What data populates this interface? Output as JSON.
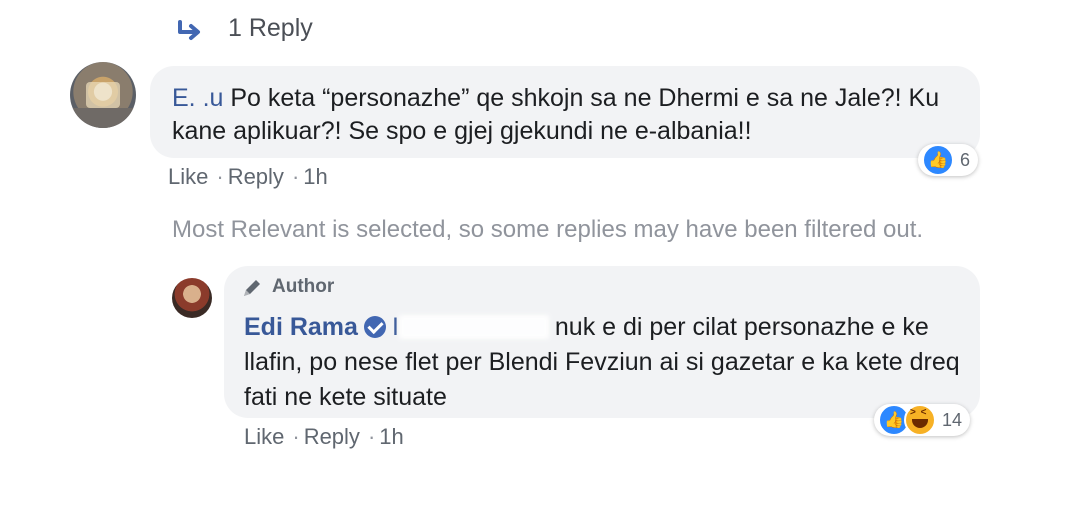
{
  "top": {
    "replies_label": "1 Reply"
  },
  "comment1": {
    "author_visible": "E.    .u",
    "text": "Po keta “personazhe” qe shkojn sa ne Dhermi e sa ne Jale?! Ku kane aplikuar?! Se spo e gjej gjekundi ne e-albania!!",
    "reactions_count": "6",
    "actions": {
      "like": "Like",
      "reply": "Reply",
      "time": "1h"
    }
  },
  "notice": "Most Relevant is selected, so some replies may have been filtered out.",
  "comment2": {
    "badge": "Author",
    "author": "Edi Rama",
    "mention_visible": "I",
    "text": "nuk e di per cilat personazhe e ke llafin, po nese flet per Blendi Fevziun ai si gazetar e ka kete dreq fati ne kete situate",
    "reactions_count": "14",
    "actions": {
      "like": "Like",
      "reply": "Reply",
      "time": "1h"
    }
  },
  "colors": {
    "link": "#385898",
    "meta": "#606770",
    "bubble": "#f2f3f5",
    "like_blue": "#2d88ff",
    "haha_yellow": "#f7b125"
  },
  "icons": [
    "reply-arrow-icon",
    "pencil-icon",
    "verified-icon",
    "like-reaction-icon",
    "haha-reaction-icon"
  ]
}
